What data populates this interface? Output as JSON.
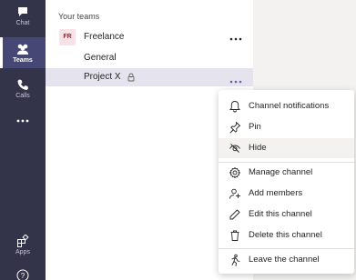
{
  "rail": {
    "items": [
      {
        "label": "Chat",
        "icon": "chat-icon"
      },
      {
        "label": "Teams",
        "icon": "teams-icon",
        "active": true
      },
      {
        "label": "Calls",
        "icon": "calls-icon"
      },
      {
        "label": "",
        "icon": "more-apps-icon"
      },
      {
        "label": "Apps",
        "icon": "apps-icon"
      },
      {
        "label": "",
        "icon": "help-icon"
      }
    ]
  },
  "teams": {
    "section_title": "Your teams",
    "team": {
      "avatar_text": "FR",
      "name": "Freelance"
    },
    "channels": [
      {
        "name": "General"
      },
      {
        "name": "Project X",
        "private": true
      }
    ]
  },
  "context_menu": {
    "items": [
      {
        "label": "Channel notifications",
        "icon": "bell-icon"
      },
      {
        "label": "Pin",
        "icon": "pin-icon"
      },
      {
        "label": "Hide",
        "icon": "hide-icon"
      },
      {
        "label": "Manage channel",
        "icon": "gear-icon"
      },
      {
        "label": "Add members",
        "icon": "add-person-icon"
      },
      {
        "label": "Edit this channel",
        "icon": "pencil-icon"
      },
      {
        "label": "Delete this channel",
        "icon": "trash-icon"
      },
      {
        "label": "Leave the channel",
        "icon": "leave-icon"
      }
    ]
  },
  "colors": {
    "rail_bg": "#33344a",
    "selected_bg": "#e5e4ee",
    "hover_bg": "#f3f2f1",
    "accent": "#6264a7"
  }
}
